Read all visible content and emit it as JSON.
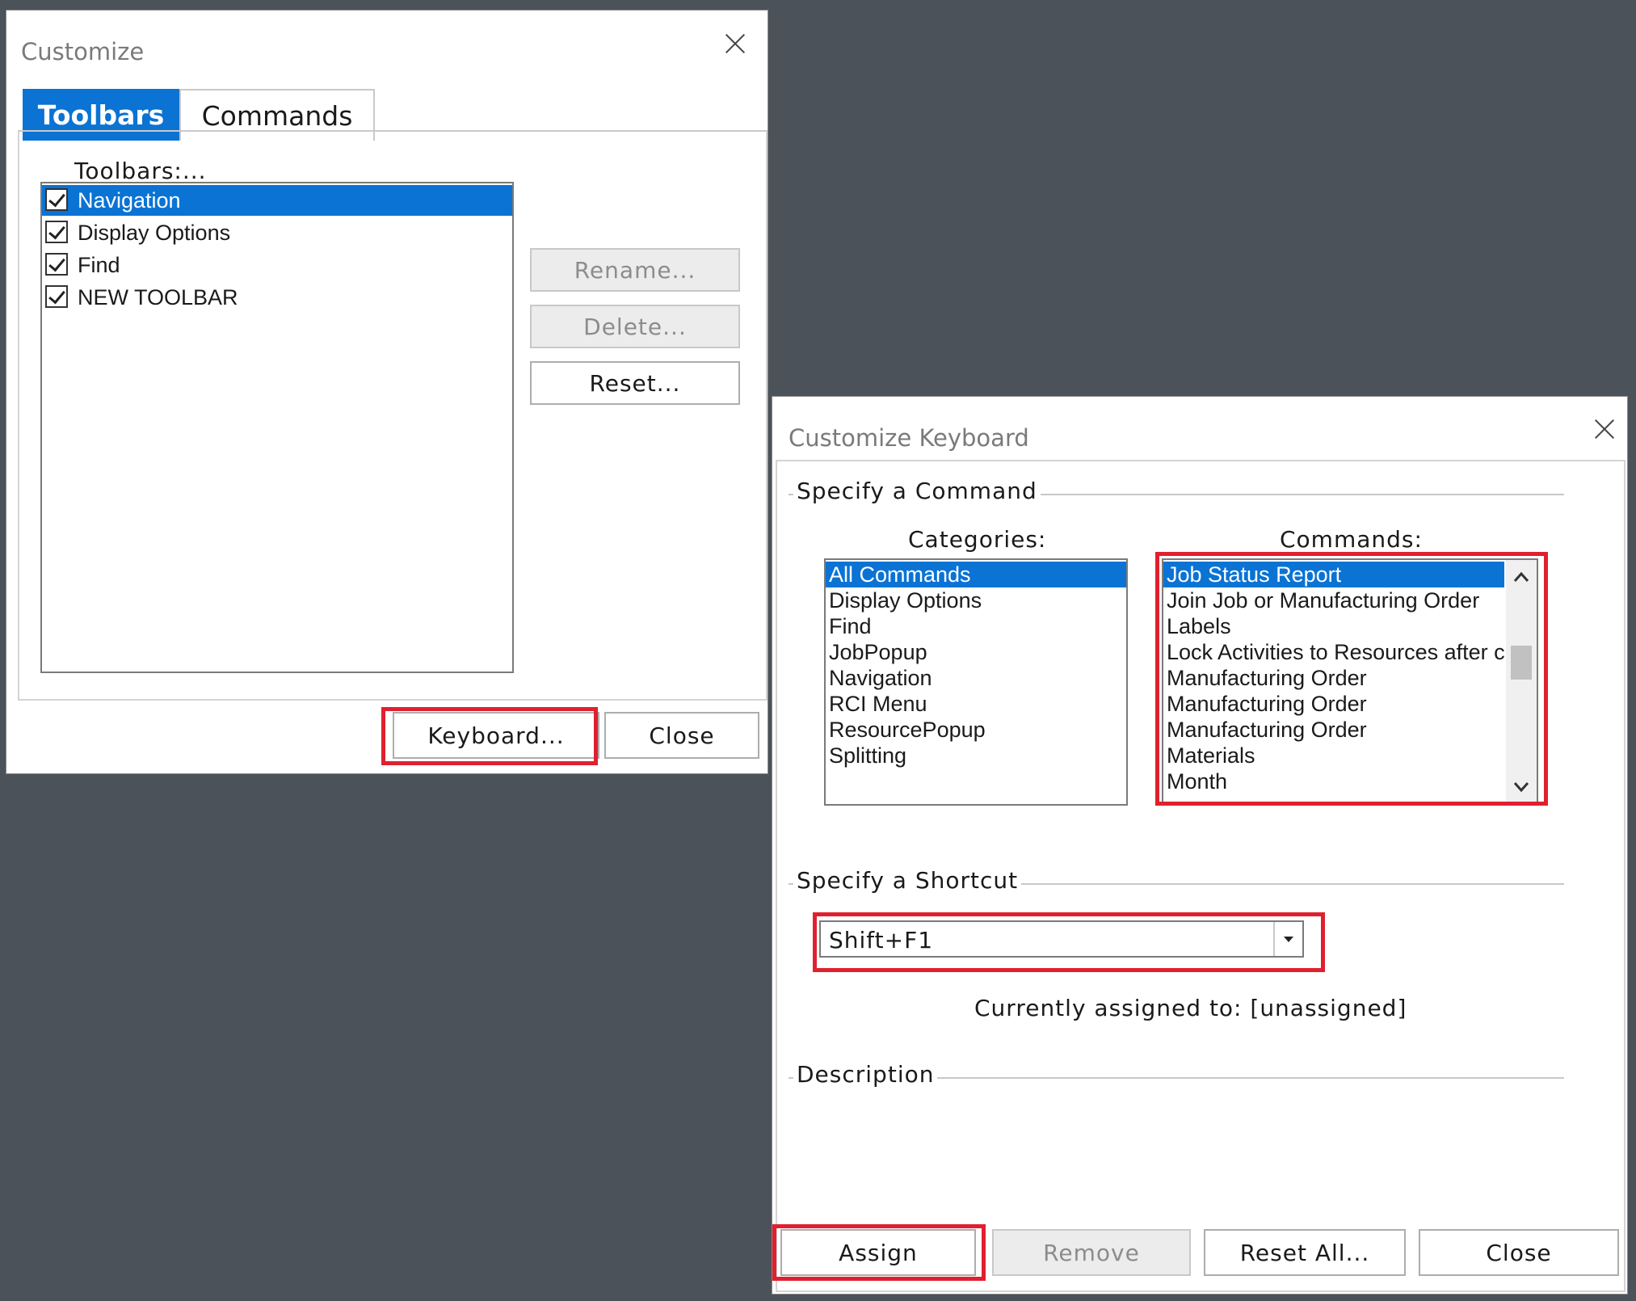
{
  "customize": {
    "title": "Customize",
    "tabs": [
      "Toolbars",
      "Commands"
    ],
    "toolbars_label": "Toolbars:...",
    "toolbars": [
      {
        "label": "Navigation",
        "checked": true,
        "selected": true
      },
      {
        "label": "Display Options",
        "checked": true,
        "selected": false
      },
      {
        "label": "Find",
        "checked": true,
        "selected": false
      },
      {
        "label": "NEW TOOLBAR",
        "checked": true,
        "selected": false
      }
    ],
    "buttons": {
      "rename": "Rename...",
      "delete": "Delete...",
      "reset": "Reset...",
      "keyboard": "Keyboard...",
      "close": "Close"
    }
  },
  "keyboard": {
    "title": "Customize Keyboard",
    "specify_command": "Specify a Command",
    "categories_label": "Categories:",
    "commands_label": "Commands:",
    "categories": [
      "All Commands",
      "Display Options",
      "Find",
      "JobPopup",
      "Navigation",
      "RCI Menu",
      "ResourcePopup",
      "Splitting"
    ],
    "commands": [
      "Job Status Report",
      "Join Job or Manufacturing Order",
      "Labels",
      "Lock Activities to Resources after c",
      "Manufacturing Order",
      "Manufacturing Order",
      "Manufacturing Order",
      "Materials",
      "Month"
    ],
    "specify_shortcut": "Specify a Shortcut",
    "shortcut_value": "Shift+F1",
    "currently_assigned": "Currently assigned to: [unassigned]",
    "description": "Description",
    "buttons": {
      "assign": "Assign",
      "remove": "Remove",
      "reset_all": "Reset All...",
      "close": "Close"
    }
  },
  "colors": {
    "accent": "#0a73d4",
    "highlight": "#e0202e",
    "backdrop": "#4b5259"
  }
}
